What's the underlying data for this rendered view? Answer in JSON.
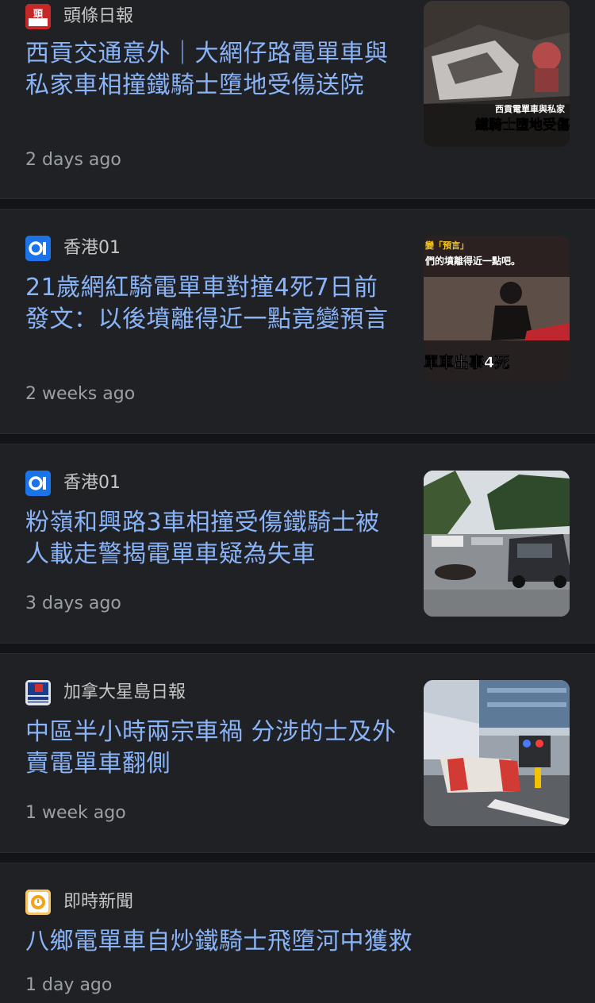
{
  "articles": [
    {
      "source": "頭條日報",
      "source_icon": "headline-daily-logo",
      "title": "西貢交通意外｜大網仔路電單車與私家車相撞鐵騎士墮地受傷送院",
      "time": "2 days ago",
      "thumb_caption_1": "西貢電單車與私家",
      "thumb_caption_2": "鐵騎士墮地受傷"
    },
    {
      "source": "香港01",
      "source_icon": "hk01-logo",
      "title": "21歲網紅騎電單車對撞4死7日前發文：以後墳離得近一點竟變預言",
      "time": "2 weeks ago",
      "thumb_caption_1": "變「預言」",
      "thumb_caption_2": "們的墳離得近一點吧。",
      "thumb_caption_3": "單車出事4死"
    },
    {
      "source": "香港01",
      "source_icon": "hk01-logo",
      "title": "粉嶺和興路3車相撞受傷鐵騎士被人載走警揭電單車疑為失車",
      "time": "3 days ago"
    },
    {
      "source": "加拿大星島日報",
      "source_icon": "singtao-canada-logo",
      "title": "中區半小時兩宗車禍 分涉的士及外賣電單車翻側",
      "time": "1 week ago"
    },
    {
      "source": "即時新聞",
      "source_icon": "instant-news-logo",
      "title": "八鄉電單車自炒鐵騎士飛墮河中獲救",
      "time": "1 day ago"
    }
  ],
  "colors": {
    "background": "#131417",
    "card": "#202124",
    "headline": "#8ab4f8",
    "source": "#c4c7c5",
    "time": "#9aa0a6"
  }
}
